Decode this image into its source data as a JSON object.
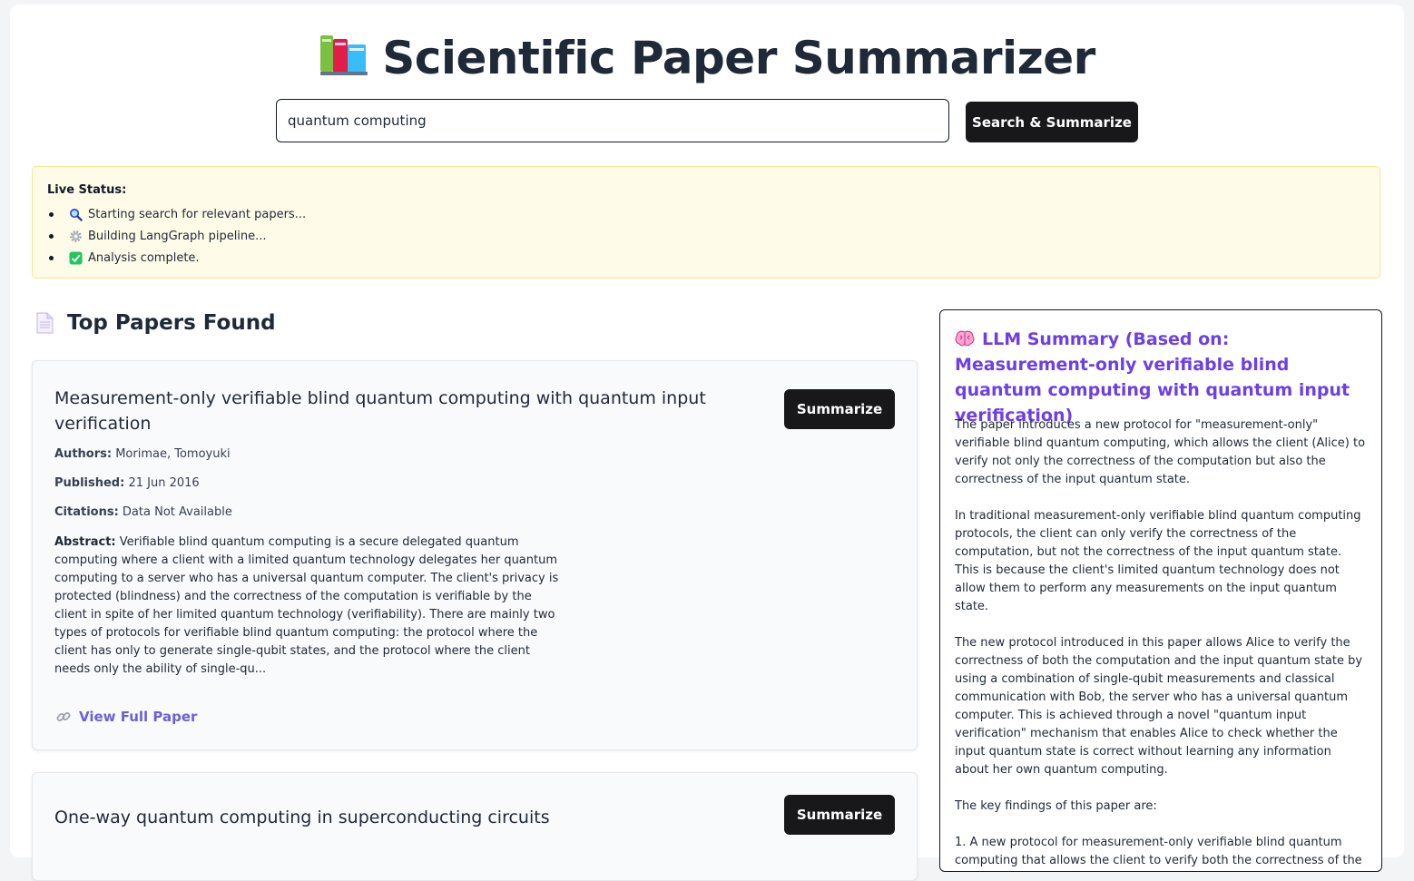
{
  "header": {
    "title": "Scientific Paper Summarizer",
    "icon": "books-icon"
  },
  "search": {
    "value": "quantum computing",
    "button_label": "Search & Summarize"
  },
  "status": {
    "title": "Live Status:",
    "items": [
      {
        "icon": "magnifier-icon",
        "text": "Starting search for relevant papers..."
      },
      {
        "icon": "gear-icon",
        "text": "Building LangGraph pipeline..."
      },
      {
        "icon": "checkmark-icon",
        "text": "Analysis complete."
      }
    ]
  },
  "papers_section": {
    "title": "Top Papers Found",
    "icon": "document-icon"
  },
  "papers": [
    {
      "title": "Measurement-only verifiable blind quantum computing with quantum input verification",
      "summarize_label": "Summarize",
      "authors_label": "Authors:",
      "authors": "Morimae, Tomoyuki",
      "published_label": "Published:",
      "published": "21 Jun 2016",
      "citations_label": "Citations:",
      "citations": "Data Not Available",
      "abstract_label": "Abstract:",
      "abstract": "Verifiable blind quantum computing is a secure delegated quantum computing where a client with a limited quantum technology delegates her quantum computing to a server who has a universal quantum computer. The client's privacy is protected (blindness) and the correctness of the computation is verifiable by the client in spite of her limited quantum technology (verifiability). There are mainly two types of protocols for verifiable blind quantum computing: the protocol where the client has only to generate single-qubit states, and the protocol where the client needs only the ability of single-qu...",
      "link_label": "View Full Paper"
    },
    {
      "title": "One-way quantum computing in superconducting circuits",
      "summarize_label": "Summarize"
    }
  ],
  "summary": {
    "title": "LLM Summary (Based on: Measurement-only verifiable blind quantum computing with quantum input verification)",
    "icon": "brain-icon",
    "paragraphs": [
      "The paper introduces a new protocol for \"measurement-only\" verifiable blind quantum computing, which allows the client (Alice) to verify not only the correctness of the computation but also the correctness of the input quantum state.",
      "In traditional measurement-only verifiable blind quantum computing protocols, the client can only verify the correctness of the computation, but not the correctness of the input quantum state. This is because the client's limited quantum technology does not allow them to perform any measurements on the input quantum state.",
      "The new protocol introduced in this paper allows Alice to verify the correctness of both the computation and the input quantum state by using a combination of single-qubit measurements and classical communication with Bob, the server who has a universal quantum computer. This is achieved through a novel \"quantum input verification\" mechanism that enables Alice to check whether the input quantum state is correct without learning any information about her own quantum computing.",
      "The key findings of this paper are:",
      "1. A new protocol for measurement-only verifiable blind quantum computing that allows the client to verify both the correctness of the"
    ]
  },
  "colors": {
    "accent": "#6d3fe6",
    "link": "#6d5fd8",
    "button": "#18181b",
    "status_bg": "#fefce8",
    "status_border": "#fde68a"
  }
}
